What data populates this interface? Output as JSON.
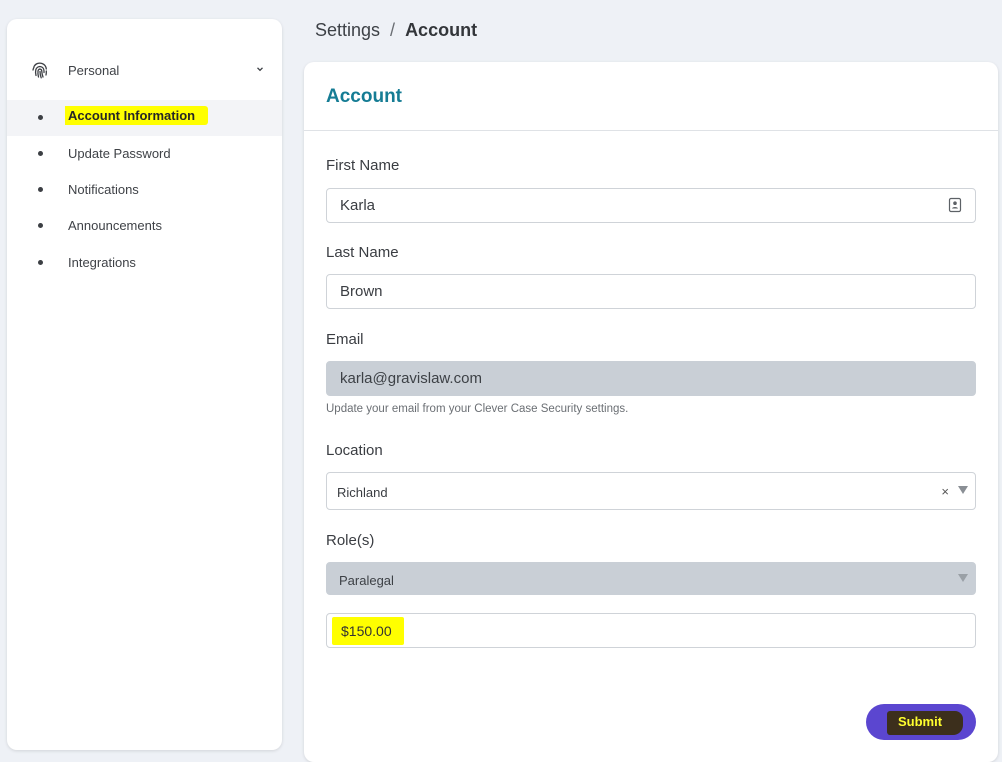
{
  "sidebar": {
    "group": {
      "label": "Personal",
      "icon": "fingerprint-icon"
    },
    "items": [
      {
        "label": "Account Information",
        "active": true
      },
      {
        "label": "Update Password",
        "active": false
      },
      {
        "label": "Notifications",
        "active": false
      },
      {
        "label": "Announcements",
        "active": false
      },
      {
        "label": "Integrations",
        "active": false
      }
    ]
  },
  "breadcrumb": {
    "parent": "Settings",
    "separator": "/",
    "current": "Account"
  },
  "form": {
    "title": "Account",
    "first_name": {
      "label": "First Name",
      "value": "Karla"
    },
    "last_name": {
      "label": "Last Name",
      "value": "Brown"
    },
    "email": {
      "label": "Email",
      "value": "karla@gravislaw.com",
      "helper": "Update your email from your Clever Case Security settings."
    },
    "location": {
      "label": "Location",
      "value": "Richland",
      "clear": "×"
    },
    "roles": {
      "label": "Role(s)",
      "value": "Paralegal"
    },
    "rate": {
      "value": "$150.00"
    },
    "submit_label": "Submit"
  },
  "colors": {
    "accent_title": "#157c94",
    "submit_bg": "#5b46d0",
    "highlight": "#ffff00",
    "disabled_field": "#c9cfd6"
  }
}
